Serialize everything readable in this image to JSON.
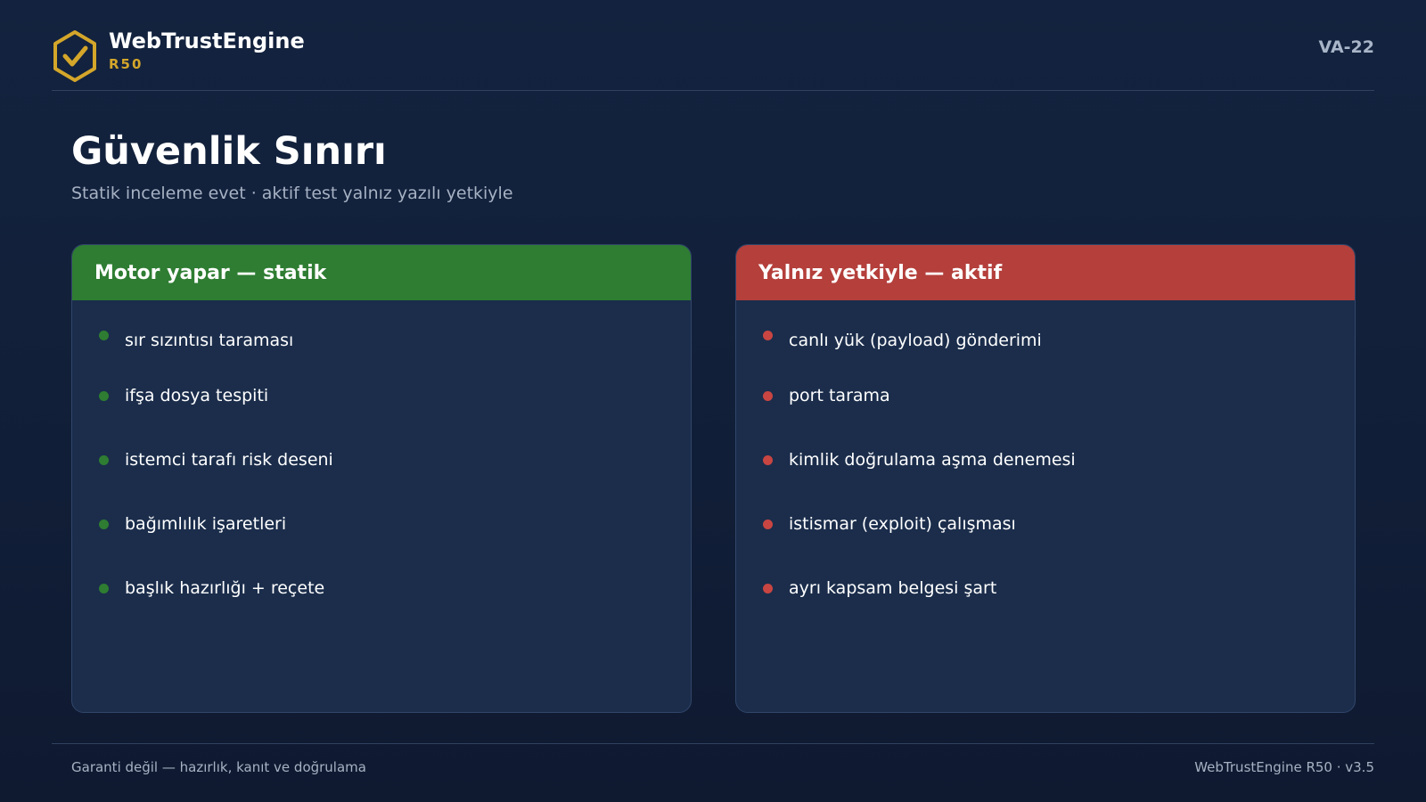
{
  "header": {
    "brand_name": "WebTrustEngine",
    "brand_sub": "R50",
    "slide_code": "VA-22",
    "logo_icon": "hexagon-check-icon",
    "logo_color": "#d4a62a"
  },
  "title": "Güvenlik Sınırı",
  "subtitle": "Statik inceleme evet · aktif test yalnız yazılı yetkiyle",
  "panels": {
    "static": {
      "title": "Motor yapar — statik",
      "color": "#2e7d32",
      "items": [
        "sır sızıntısı taraması",
        "ifşa dosya tespiti",
        "istemci tarafı risk deseni",
        "bağımlılık işaretleri",
        "başlık hazırlığı + reçete"
      ]
    },
    "active": {
      "title": "Yalnız yetkiyle — aktif",
      "color": "#b43f3b",
      "items": [
        "canlı yük (payload) gönderimi",
        "port tarama",
        "kimlik doğrulama aşma denemesi",
        "istismar (exploit) çalışması",
        "ayrı kapsam belgesi şart"
      ]
    }
  },
  "footer": {
    "left": "Garanti değil — hazırlık, kanıt ve doğrulama",
    "right": "WebTrustEngine R50 · v3.5"
  }
}
